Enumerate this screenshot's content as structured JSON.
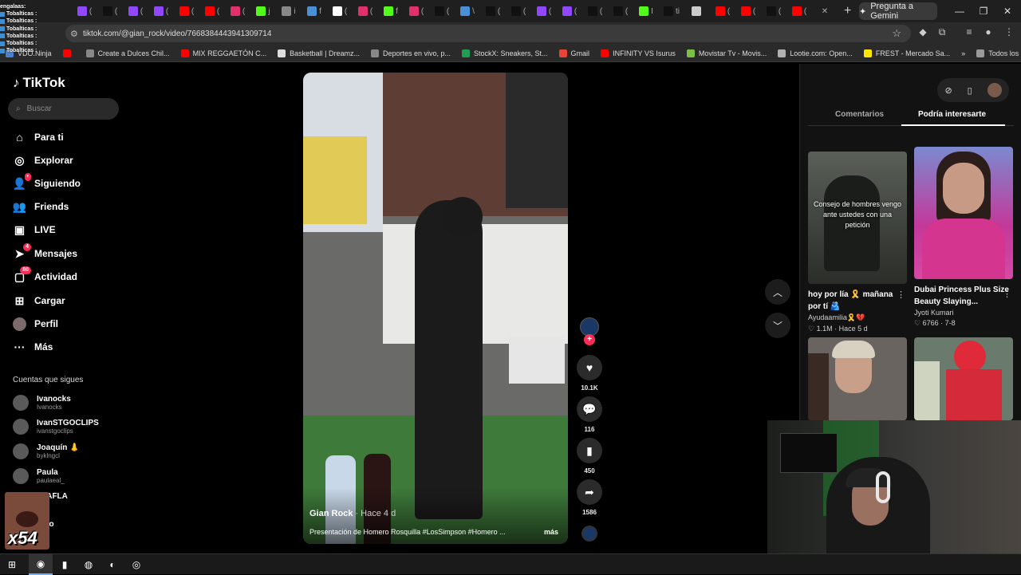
{
  "browser": {
    "url": "tiktok.com/@gian_rock/video/7668384443941309714",
    "gemini_label": "Pregunta a Gemini",
    "tabs": [
      {
        "icon": "twitch-icon",
        "color": "#9146ff",
        "text": "("
      },
      {
        "icon": "tiktok-icon",
        "color": "#111111",
        "text": "("
      },
      {
        "icon": "twitch-icon",
        "color": "#9146ff",
        "text": "("
      },
      {
        "icon": "twitch-icon",
        "color": "#9146ff",
        "text": "("
      },
      {
        "icon": "youtube-icon",
        "color": "#ff0000",
        "text": "("
      },
      {
        "icon": "youtube-icon",
        "color": "#ff0000",
        "text": "("
      },
      {
        "icon": "instagram-icon",
        "color": "#e1306c",
        "text": "("
      },
      {
        "icon": "kick-icon",
        "color": "#53fc18",
        "text": "j"
      },
      {
        "icon": "web-icon",
        "color": "#888888",
        "text": "i"
      },
      {
        "icon": "app-icon",
        "color": "#4a90d9",
        "text": "f"
      },
      {
        "icon": "threads-icon",
        "color": "#ffffff",
        "text": "("
      },
      {
        "icon": "instagram-icon",
        "color": "#e1306c",
        "text": "("
      },
      {
        "icon": "kick-icon",
        "color": "#53fc18",
        "text": "f"
      },
      {
        "icon": "instagram-icon",
        "color": "#e1306c",
        "text": "("
      },
      {
        "icon": "tiktok-icon",
        "color": "#111111",
        "text": "("
      },
      {
        "icon": "app-icon",
        "color": "#4a90d9",
        "text": "\\"
      },
      {
        "icon": "tiktok-icon",
        "color": "#111111",
        "text": "("
      },
      {
        "icon": "tiktok-icon",
        "color": "#111111",
        "text": "("
      },
      {
        "icon": "twitch-icon",
        "color": "#9146ff",
        "text": "("
      },
      {
        "icon": "twitch-icon",
        "color": "#9146ff",
        "text": "("
      },
      {
        "icon": "tiktok-icon",
        "color": "#111111",
        "text": "("
      },
      {
        "icon": "tiktok-icon",
        "color": "#111111",
        "text": "("
      },
      {
        "icon": "kick-icon",
        "color": "#53fc18",
        "text": "I"
      },
      {
        "icon": "tiktok-icon",
        "color": "#111111",
        "text": "ti"
      },
      {
        "icon": "audio-icon",
        "color": "#cccccc",
        "text": ""
      },
      {
        "icon": "youtube-icon",
        "color": "#ff0000",
        "text": "("
      },
      {
        "icon": "youtube-icon",
        "color": "#ff0000",
        "text": "("
      },
      {
        "icon": "tiktok-icon",
        "color": "#111111",
        "text": "("
      },
      {
        "icon": "youtube-icon",
        "color": "#ff0000",
        "text": "("
      },
      {
        "icon": "close-icon",
        "color": "#cccccc",
        "text": "✕"
      }
    ],
    "bookmarks": [
      {
        "icon": "vdoninja-icon",
        "color": "#4a7fd6",
        "label": "VDO.Ninja"
      },
      {
        "icon": "youtube-icon",
        "color": "#ff0000",
        "label": ""
      },
      {
        "icon": "bookmark-icon",
        "color": "#888888",
        "label": "Create a Dulces Chil..."
      },
      {
        "icon": "youtube-icon",
        "color": "#ff0000",
        "label": "MIX REGGAETÓN C..."
      },
      {
        "icon": "page-icon",
        "color": "#dddddd",
        "label": "Basketball | Dreamz..."
      },
      {
        "icon": "globe-icon",
        "color": "#888888",
        "label": "Deportes en vivo, p..."
      },
      {
        "icon": "stockx-icon",
        "color": "#1f9d55",
        "label": "StockX: Sneakers, St..."
      },
      {
        "icon": "gmail-icon",
        "color": "#ea4335",
        "label": "Gmail"
      },
      {
        "icon": "youtube-icon",
        "color": "#ff0000",
        "label": "INFINITY VS Isurus"
      },
      {
        "icon": "movistar-icon",
        "color": "#7ac142",
        "label": "Movistar Tv - Movis..."
      },
      {
        "icon": "lootie-icon",
        "color": "#b0b0b0",
        "label": "Lootie.com: Open..."
      },
      {
        "icon": "mercado-icon",
        "color": "#ffe600",
        "label": "FREST - Mercado Sa..."
      }
    ],
    "bookmarks_more": "»",
    "all_bookmarks": "Todos los marcadores"
  },
  "chat_overlay": [
    "engalaas:",
    "Tobalticas :",
    "Tobalticas :",
    "Tobalticas :",
    "Tobalticas :",
    "Tobalticas :",
    "Tobalticas :"
  ],
  "sidebar": {
    "logo": "TikTok",
    "search_placeholder": "Buscar",
    "nav": [
      {
        "label": "Para ti",
        "icon": "home-icon",
        "glyph": "⌂",
        "badge": ""
      },
      {
        "label": "Explorar",
        "icon": "compass-icon",
        "glyph": "◎",
        "badge": ""
      },
      {
        "label": "Siguiendo",
        "icon": "following-icon",
        "glyph": "👤",
        "badge": "•"
      },
      {
        "label": "Friends",
        "icon": "friends-icon",
        "glyph": "👥",
        "badge": ""
      },
      {
        "label": "LIVE",
        "icon": "live-icon",
        "glyph": "▣",
        "badge": ""
      },
      {
        "label": "Mensajes",
        "icon": "messages-icon",
        "glyph": "➤",
        "badge": "4"
      },
      {
        "label": "Actividad",
        "icon": "activity-icon",
        "glyph": "▢",
        "badge": "80"
      },
      {
        "label": "Cargar",
        "icon": "upload-icon",
        "glyph": "⊞",
        "badge": ""
      },
      {
        "label": "Perfil",
        "icon": "profile-icon",
        "glyph": "●",
        "badge": ""
      },
      {
        "label": "Más",
        "icon": "more-icon",
        "glyph": "···",
        "badge": ""
      }
    ],
    "following_title": "Cuentas que sigues",
    "accounts": [
      {
        "name": "Ivanocks",
        "handle": "Ivanocks"
      },
      {
        "name": "IvanSTGOCLIPS",
        "handle": "ivanstgoclips"
      },
      {
        "name": "Joaquín 👃",
        "handle": "byklngcl"
      },
      {
        "name": "Paula",
        "handle": "paulaeal_"
      },
      {
        "name": "FLAFLA",
        "handle": "v"
      },
      {
        "name": "todo",
        "handle": ""
      }
    ]
  },
  "video": {
    "author": "Gian Rock",
    "time": " · Hace 4 d",
    "caption": "Presentación de Homero Rosquilla #LosSimpson #Homero ...",
    "more": "más"
  },
  "actions": {
    "likes": "10.1K",
    "comments": "116",
    "saves": "450",
    "shares": "1586"
  },
  "right_panel": {
    "tab_comments": "Comentarios",
    "tab_suggested": "Podría interesarte",
    "cards": [
      {
        "overlay": "Consejo de hombres vengo ante ustedes con una petición",
        "title": "hoy por lía 🎗️ mañana por tí 🫂",
        "author": "Ayudaamilia🎗️💔",
        "stats": "♡ 1.1M · Hace 5 d"
      },
      {
        "overlay": "",
        "title": "Dubai Princess Plus Size Beauty Slaying...",
        "author": "Jyoti Kumari",
        "stats": "♡ 6766 · 7-8"
      },
      {
        "overlay": "",
        "title": "",
        "author": "",
        "stats": ""
      },
      {
        "overlay": "",
        "title": "",
        "author": "",
        "stats": ""
      }
    ]
  },
  "emote_count": "x54",
  "taskbar": [
    {
      "icon": "windows-start-icon",
      "glyph": "⊞",
      "active": false
    },
    {
      "icon": "chrome-icon",
      "glyph": "◉",
      "active": true
    },
    {
      "icon": "app-icon",
      "glyph": "▮",
      "active": false
    },
    {
      "icon": "obs-icon",
      "glyph": "◍",
      "active": false
    },
    {
      "icon": "steam-icon",
      "glyph": "◐",
      "active": false
    },
    {
      "icon": "obs-icon",
      "glyph": "◎",
      "active": false
    }
  ]
}
